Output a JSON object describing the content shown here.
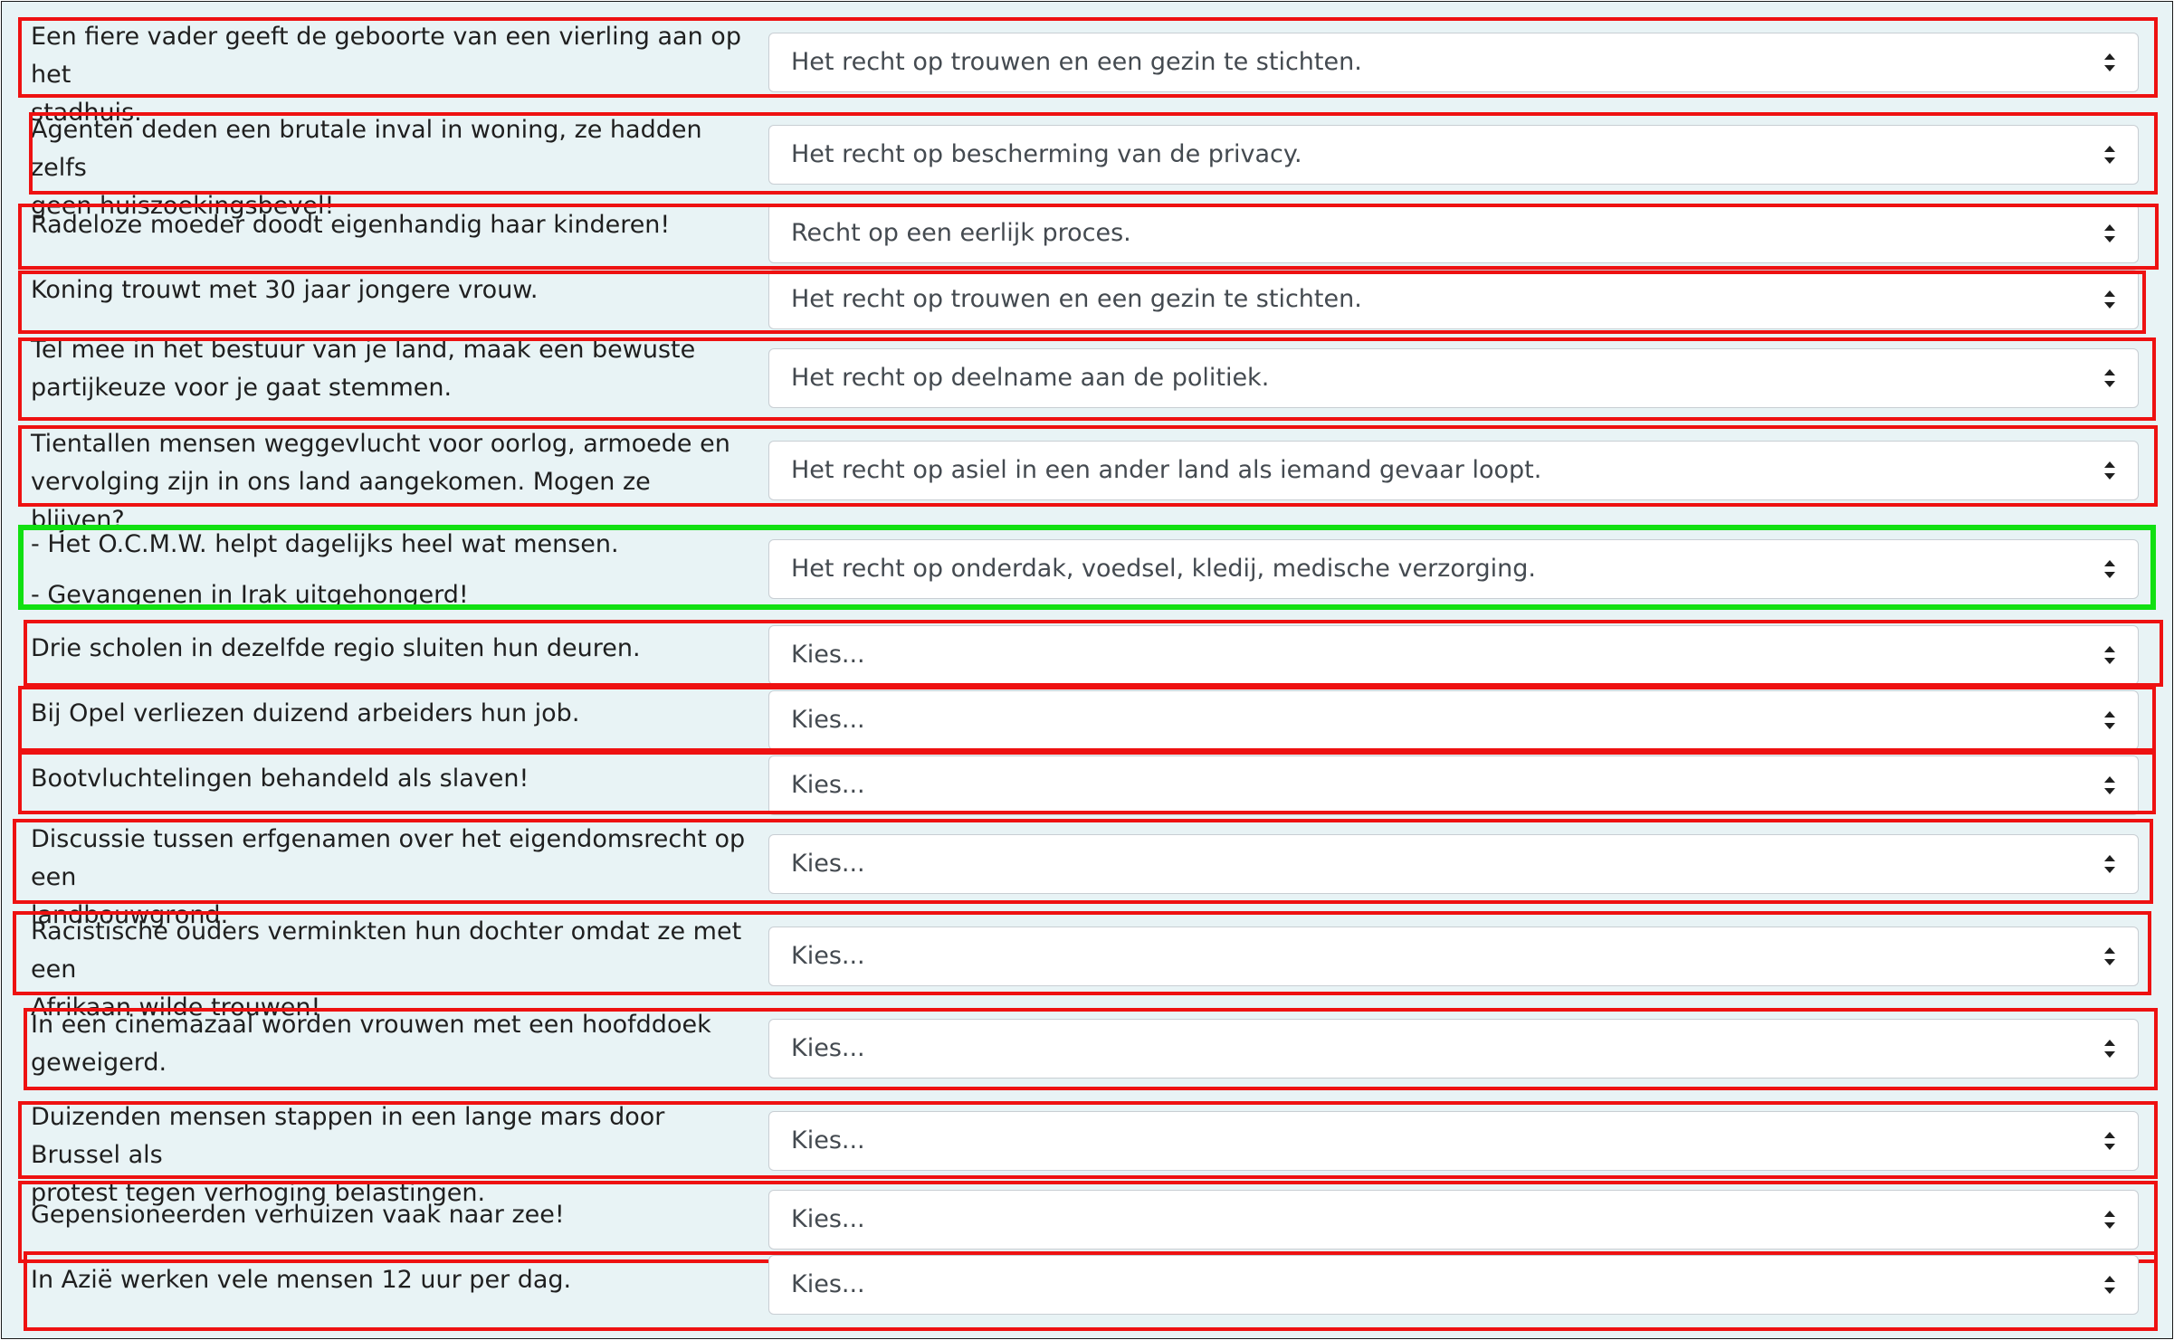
{
  "colors": {
    "wrong_border": "#ee1111",
    "correct_border": "#11e011",
    "background": "#e8f3f5"
  },
  "icons": {
    "select_arrow": "sort-arrows-icon"
  },
  "rows": [
    {
      "lines": [
        "Een fiere vader geeft de geboorte van een vierling aan op het",
        "stadhuis."
      ],
      "selected": "Het recht op trouwen en een gezin te stichten.",
      "status": "wrong"
    },
    {
      "lines": [
        "Agenten deden een brutale inval in woning, ze hadden zelfs",
        "geen huiszoekingsbevel!"
      ],
      "selected": "Het recht op bescherming van de privacy.",
      "status": "wrong"
    },
    {
      "lines": [
        "Radeloze moeder doodt eigenhandig haar kinderen!"
      ],
      "selected": "Recht op een eerlijk proces.",
      "status": "wrong"
    },
    {
      "lines": [
        "Koning trouwt met 30 jaar jongere vrouw."
      ],
      "selected": "Het recht op trouwen en een gezin te stichten.",
      "status": "wrong"
    },
    {
      "lines": [
        "Tel mee in het bestuur van je land, maak een bewuste",
        "partijkeuze voor je gaat stemmen."
      ],
      "selected": "Het recht op deelname aan de politiek.",
      "status": "wrong"
    },
    {
      "lines": [
        "Tientallen mensen weggevlucht voor oorlog, armoede en",
        "vervolging zijn in ons land aangekomen. Mogen ze blijven?"
      ],
      "selected": "Het recht op asiel in een ander land als iemand gevaar loopt.",
      "status": "wrong"
    },
    {
      "lines": [
        "- Het O.C.M.W. helpt dagelijks heel wat mensen.",
        "- Gevangenen in Irak uitgehongerd!"
      ],
      "selected": "Het recht op onderdak, voedsel, kledij, medische verzorging.",
      "status": "correct"
    },
    {
      "lines": [
        "Drie scholen in dezelfde regio sluiten hun deuren."
      ],
      "selected": "Kies...",
      "status": "wrong"
    },
    {
      "lines": [
        "Bij Opel verliezen duizend arbeiders hun job."
      ],
      "selected": "Kies...",
      "status": "wrong"
    },
    {
      "lines": [
        "Bootvluchtelingen behandeld als slaven!"
      ],
      "selected": "Kies...",
      "status": "wrong"
    },
    {
      "lines": [
        "Discussie tussen erfgenamen over het eigendomsrecht op een",
        "landbouwgrond."
      ],
      "selected": "Kies...",
      "status": "wrong"
    },
    {
      "lines": [
        "Racistische ouders verminkten hun dochter omdat ze met een",
        "Afrikaan wilde trouwen!"
      ],
      "selected": "Kies...",
      "status": "wrong"
    },
    {
      "lines": [
        "In een cinemazaal worden vrouwen met een hoofddoek",
        "geweigerd."
      ],
      "selected": "Kies...",
      "status": "wrong"
    },
    {
      "lines": [
        "Duizenden mensen stappen in een lange mars door Brussel als",
        "protest tegen verhoging belastingen."
      ],
      "selected": "Kies...",
      "status": "wrong"
    },
    {
      "lines": [
        "Gepensioneerden verhuizen vaak naar zee!"
      ],
      "selected": "Kies...",
      "status": "wrong"
    },
    {
      "lines": [
        "In Azië werken vele mensen 12 uur per dag."
      ],
      "selected": "Kies...",
      "status": "wrong"
    }
  ]
}
